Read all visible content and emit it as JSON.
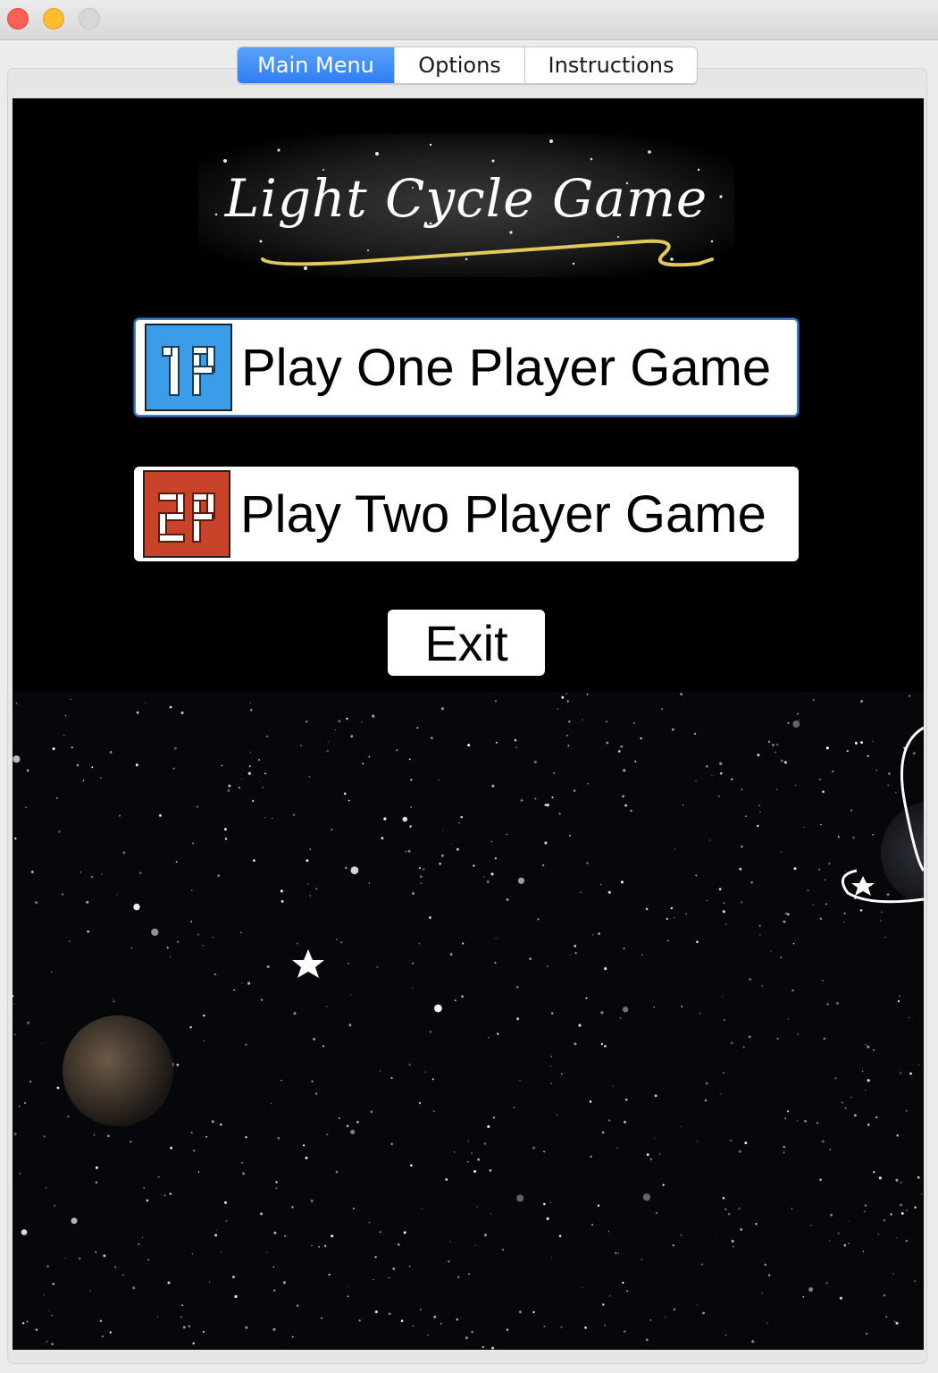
{
  "tabs": {
    "main_menu": "Main Menu",
    "options": "Options",
    "instructions": "Instructions"
  },
  "logo": {
    "text": "Light Cycle Game"
  },
  "menu": {
    "one_player": {
      "badge": "1P",
      "label": "Play One Player Game",
      "badge_color": "#3b9de8"
    },
    "two_player": {
      "badge": "2P",
      "label": "Play Two Player Game",
      "badge_color": "#c9432a"
    },
    "exit": "Exit"
  },
  "colors": {
    "active_tab": "#2f7df6",
    "background": "#000000",
    "logo_swoosh": "#e3c85a"
  }
}
